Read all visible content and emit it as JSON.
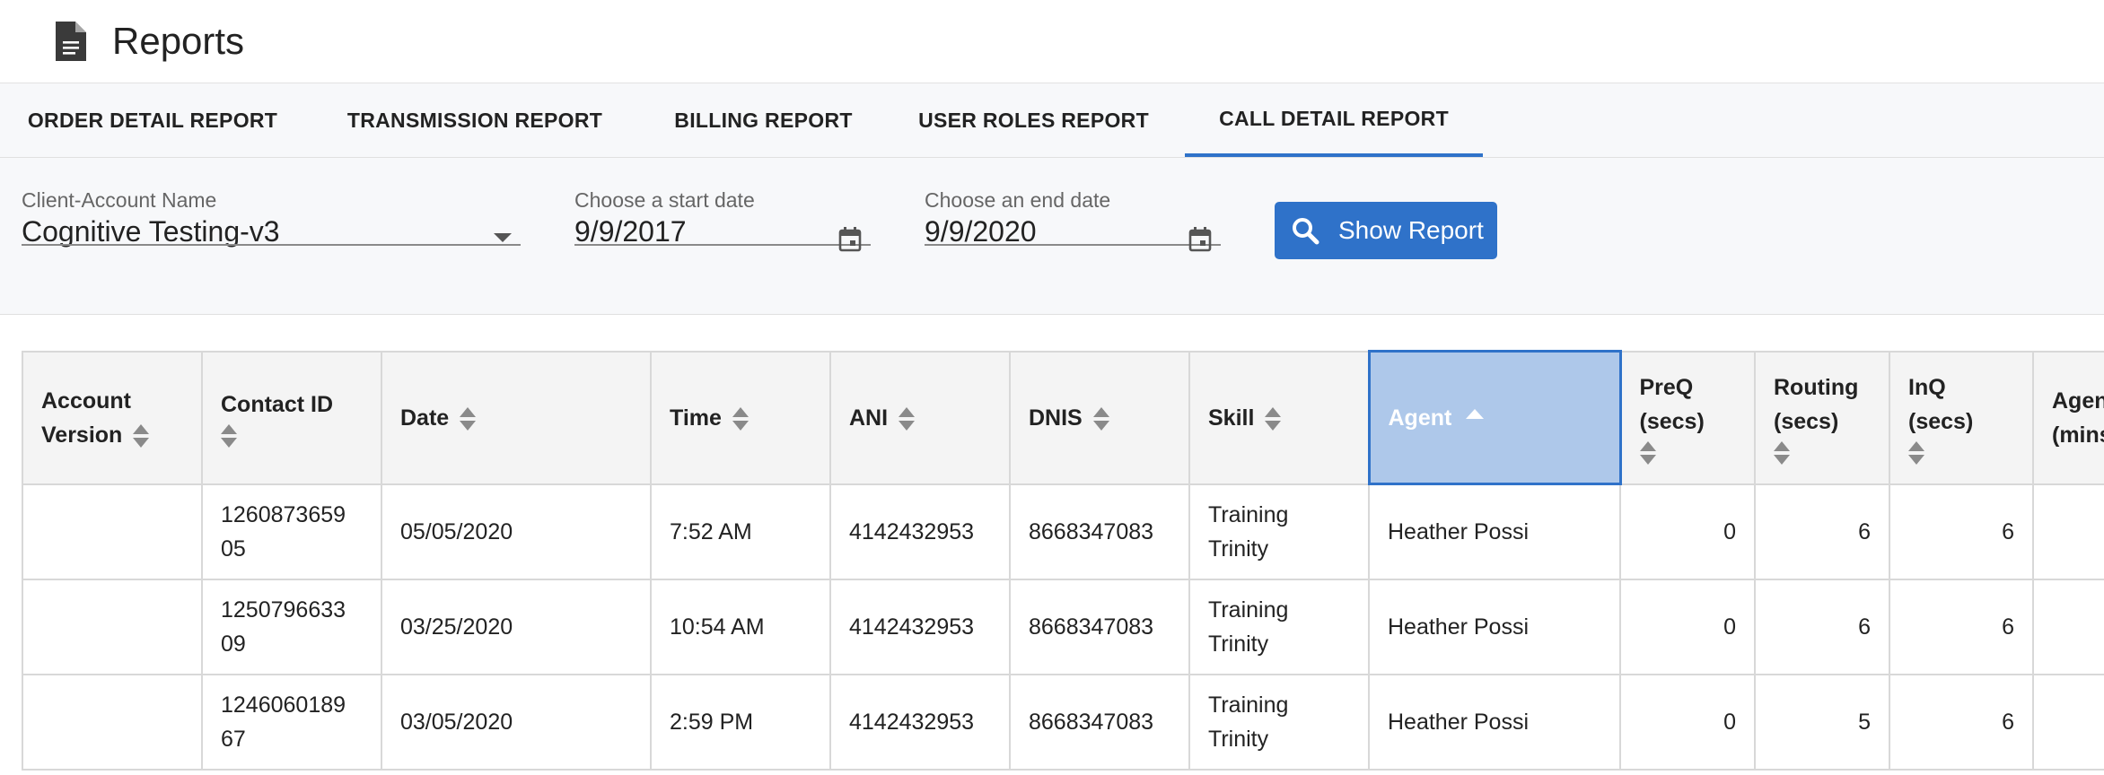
{
  "header": {
    "title": "Reports",
    "icon": "document-icon"
  },
  "tabs": [
    {
      "label": "ORDER DETAIL REPORT",
      "active": false
    },
    {
      "label": "TRANSMISSION REPORT",
      "active": false
    },
    {
      "label": "BILLING REPORT",
      "active": false
    },
    {
      "label": "USER ROLES REPORT",
      "active": false
    },
    {
      "label": "CALL DETAIL REPORT",
      "active": true
    }
  ],
  "filters": {
    "client_label": "Client-Account Name",
    "client_value": "Cognitive Testing-v3",
    "start_label": "Choose a start date",
    "start_value": "9/9/2017",
    "end_label": "Choose an end date",
    "end_value": "9/9/2020",
    "show_report_label": "Show Report"
  },
  "colors": {
    "accent": "#2f72c9",
    "active_header": "#aec8ea"
  },
  "table": {
    "headers": {
      "account_version": [
        "Account",
        "Version"
      ],
      "contact_id": "Contact ID",
      "date": "Date",
      "time": "Time",
      "ani": "ANI",
      "dnis": "DNIS",
      "skill": "Skill",
      "agent": "Agent",
      "preq": [
        "PreQ",
        "(secs)"
      ],
      "routing": [
        "Routing",
        "(secs)"
      ],
      "inq": [
        "InQ",
        "(secs)"
      ],
      "agent_mins": [
        "Agen",
        "(mins"
      ]
    },
    "rows": [
      {
        "account_version": "",
        "contact_id": [
          "1260873659",
          "05"
        ],
        "date": "05/05/2020",
        "time": "7:52 AM",
        "ani": "4142432953",
        "dnis": "8668347083",
        "skill": [
          "Training",
          "Trinity"
        ],
        "agent": "Heather Possi",
        "preq": "0",
        "routing": "6",
        "inq": "6",
        "agent_mins": ""
      },
      {
        "account_version": "",
        "contact_id": [
          "1250796633",
          "09"
        ],
        "date": "03/25/2020",
        "time": "10:54 AM",
        "ani": "4142432953",
        "dnis": "8668347083",
        "skill": [
          "Training",
          "Trinity"
        ],
        "agent": "Heather Possi",
        "preq": "0",
        "routing": "6",
        "inq": "6",
        "agent_mins": ""
      },
      {
        "account_version": "",
        "contact_id": [
          "1246060189",
          "67"
        ],
        "date": "03/05/2020",
        "time": "2:59 PM",
        "ani": "4142432953",
        "dnis": "8668347083",
        "skill": [
          "Training",
          "Trinity"
        ],
        "agent": "Heather Possi",
        "preq": "0",
        "routing": "5",
        "inq": "6",
        "agent_mins": ""
      }
    ]
  }
}
